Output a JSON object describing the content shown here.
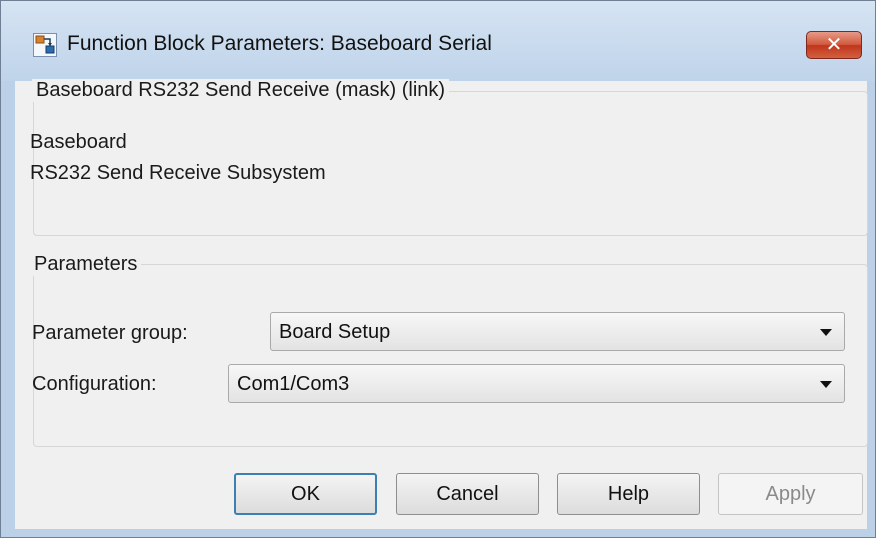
{
  "window": {
    "title": "Function Block Parameters: Baseboard Serial",
    "close_symbol": "✕"
  },
  "mask": {
    "legend": "Baseboard RS232 Send Receive (mask) (link)",
    "description": [
      "Baseboard",
      "RS232 Send Receive Subsystem"
    ]
  },
  "parameters": {
    "legend": "Parameters",
    "parameter_group": {
      "label": "Parameter group:",
      "value": "Board Setup"
    },
    "configuration": {
      "label": "Configuration:",
      "value": "Com1/Com3"
    }
  },
  "buttons": {
    "ok": "OK",
    "cancel": "Cancel",
    "help": "Help",
    "apply": "Apply"
  },
  "colors": {
    "default_button_border": "#3c7fb1",
    "close_button": "#c0351b",
    "title_bar": "#bfd3ea"
  },
  "icons": [
    "simulink-block-icon",
    "close-icon",
    "dropdown-arrow-icon"
  ]
}
